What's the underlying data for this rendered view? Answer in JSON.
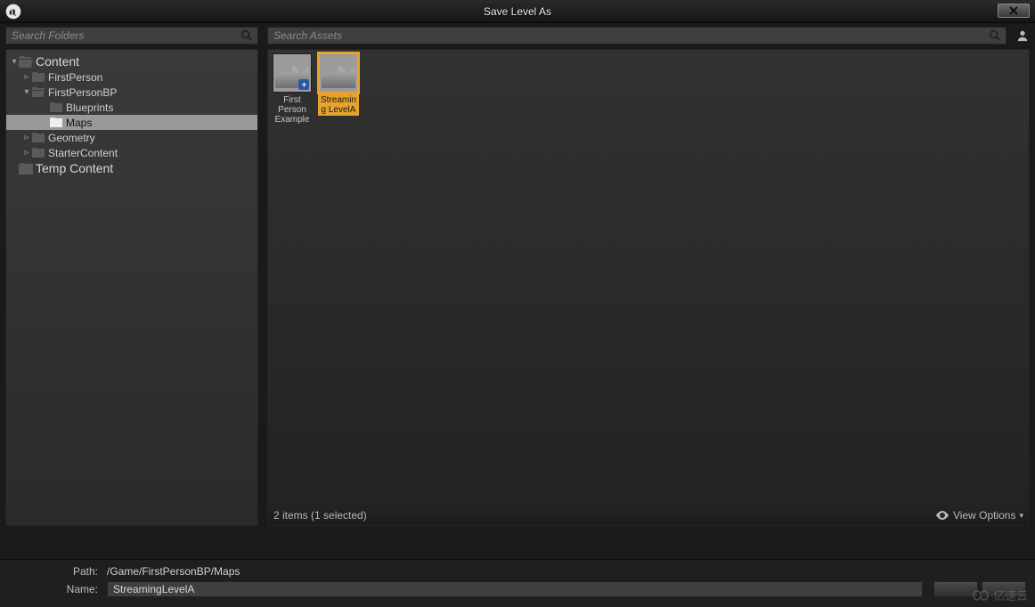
{
  "window": {
    "title": "Save Level As"
  },
  "searches": {
    "folders_placeholder": "Search Folders",
    "assets_placeholder": "Search Assets"
  },
  "tree": {
    "content_label": "Content",
    "temp_label": "Temp Content",
    "items": [
      {
        "label": "FirstPerson"
      },
      {
        "label": "FirstPersonBP",
        "children": [
          {
            "label": "Blueprints"
          },
          {
            "label": "Maps",
            "selected": true
          }
        ]
      },
      {
        "label": "Geometry"
      },
      {
        "label": "StarterContent"
      }
    ]
  },
  "assets": [
    {
      "name": "First Person Example",
      "selected": false
    },
    {
      "name": "Streaming LevelA",
      "selected": true
    }
  ],
  "status": {
    "count_text": "2 items (1 selected)",
    "view_options_label": "View Options"
  },
  "bottom": {
    "path_label": "Path:",
    "path_value": "/Game/FirstPersonBP/Maps",
    "name_label": "Name:",
    "name_value": "StreamingLevelA"
  },
  "watermark": "亿速云"
}
